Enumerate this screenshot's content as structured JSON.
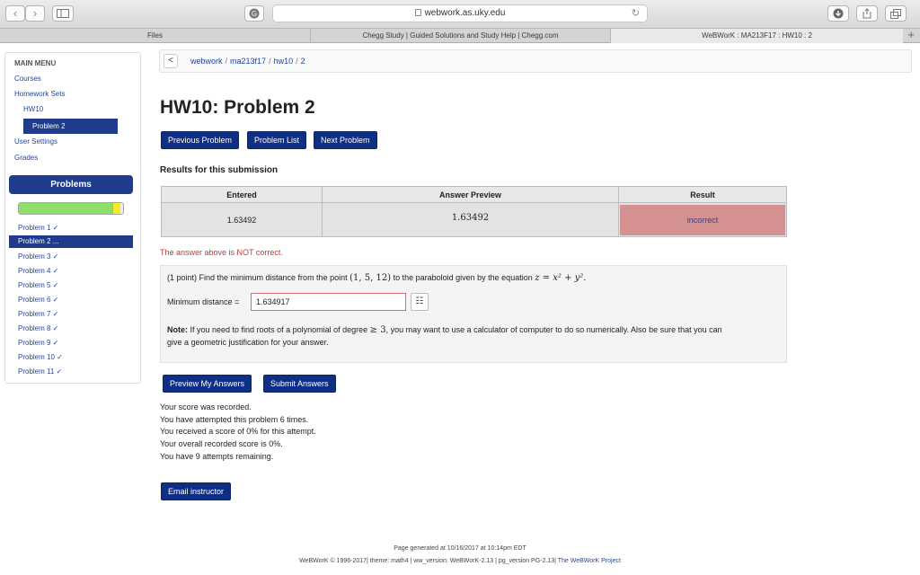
{
  "browser": {
    "back_glyph": "‹",
    "forward_glyph": "›",
    "url": "webwork.as.uky.edu",
    "reload_glyph": "↻",
    "new_tab_glyph": "+",
    "tabs": [
      {
        "label": "Files"
      },
      {
        "label": "Chegg Study | Guided Solutions and Study Help | Chegg.com"
      },
      {
        "label": "WeBWorK : MA213F17 : HW10 : 2"
      }
    ]
  },
  "sidebar": {
    "menu_title": "MAIN MENU",
    "courses": "Courses",
    "homework_sets": "Homework Sets",
    "hw10": "HW10",
    "current_problem": "Problem 2",
    "user_settings": "User Settings",
    "grades": "Grades",
    "problems_header": "Problems",
    "progress_fraction": 0.9,
    "problems": [
      {
        "label": "Problem 1 ✓"
      },
      {
        "label": "Problem 2 ..."
      },
      {
        "label": "Problem 3 ✓"
      },
      {
        "label": "Problem 4 ✓"
      },
      {
        "label": "Problem 5 ✓"
      },
      {
        "label": "Problem 6 ✓"
      },
      {
        "label": "Problem 7 ✓"
      },
      {
        "label": "Problem 8 ✓"
      },
      {
        "label": "Problem 9 ✓"
      },
      {
        "label": "Problem 10 ✓"
      },
      {
        "label": "Problem 11 ✓"
      }
    ]
  },
  "breadcrumb": {
    "back_glyph": "<",
    "items": [
      "webwork",
      "ma213f17",
      "hw10",
      "2"
    ]
  },
  "main": {
    "title": "HW10: Problem 2",
    "prev_button": "Previous Problem",
    "list_button": "Problem List",
    "next_button": "Next Problem",
    "results_heading": "Results for this submission",
    "results": {
      "headers": [
        "Entered",
        "Answer Preview",
        "Result"
      ],
      "entered": "1.63492",
      "preview": "1.63492",
      "result": "incorrect"
    },
    "not_correct": "The answer above is NOT correct.",
    "problem": {
      "intro": "(1 point) Find the minimum distance from the point",
      "point": "(1, 5, 12)",
      "mid": "to the paraboloid given by the equation",
      "equation": "z = x² + y².",
      "answer_label": "Minimum distance =",
      "answer_value": "1.634917",
      "keypad_glyph": "☷",
      "note_label": "Note:",
      "note_text_1": "If you need to find roots of a polynomial of degree",
      "note_math": "≥ 3",
      "note_text_2": ", you may want to use a calculator of computer to do so numerically. Also be sure that you can",
      "note_text_3": "give a geometric justification for your answer."
    },
    "preview_button": "Preview My Answers",
    "submit_button": "Submit Answers",
    "status": [
      "Your score was recorded.",
      "You have attempted this problem 6 times.",
      "You received a score of 0% for this attempt.",
      "Your overall recorded score is 0%.",
      "You have 9 attempts remaining."
    ],
    "email_button": "Email instructor"
  },
  "footer": {
    "generated": "Page generated at 10/16/2017 at 10:14pm EDT",
    "version": "WeBWorK © 1996-2017| theme: math4 | ww_version: WeBWorK-2.13 | pg_version PG-2.13|",
    "project": "The WeBWorK Project"
  },
  "colors": {
    "primary_button": "#0e2f83",
    "incorrect_bg": "#d49191",
    "error_text": "#c23a3a",
    "progress_fill": "#8ce06a"
  }
}
